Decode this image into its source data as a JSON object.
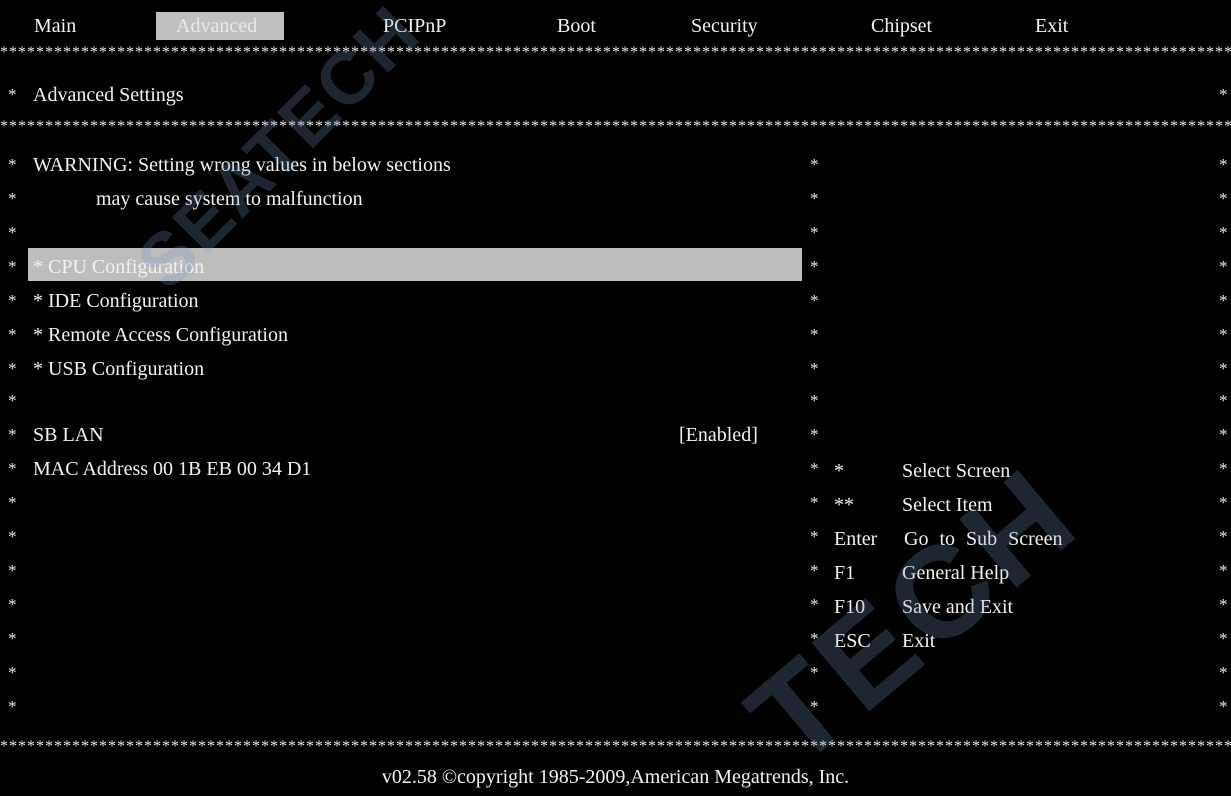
{
  "menu": {
    "items": [
      "Main",
      "Advanced",
      "PCIPnP",
      "Boot",
      "Security",
      "Chipset",
      "Exit"
    ],
    "active": "Advanced"
  },
  "section": {
    "title": "Advanced Settings"
  },
  "warning": {
    "line1": "WARNING: Setting wrong values in below sections",
    "line2": "may cause system to malfunction"
  },
  "submenus": [
    "* CPU Configuration",
    "* IDE Configuration",
    "* Remote Access Configuration",
    "* USB Configuration"
  ],
  "settings": {
    "sb_lan_label": "SB LAN",
    "sb_lan_value": "[Enabled]",
    "mac_label": "MAC Address 00 1B EB 00 34 D1"
  },
  "help": [
    {
      "key": "*",
      "desc": "Select Screen"
    },
    {
      "key": "**",
      "desc": "Select Item"
    },
    {
      "key": "Enter",
      "desc": "Go to Sub Screen"
    },
    {
      "key": "F1",
      "desc": "General Help"
    },
    {
      "key": "F10",
      "desc": "Save and Exit"
    },
    {
      "key": "ESC",
      "desc": "Exit"
    }
  ],
  "footer": "v02.58 ©copyright  1985-2009,American Megatrends, Inc.",
  "watermark": {
    "text1": "SEATECH",
    "text2": "TECH"
  },
  "colors": {
    "background": "#000000",
    "foreground": "#f2f2f2",
    "highlight": "#bdbdbd"
  }
}
